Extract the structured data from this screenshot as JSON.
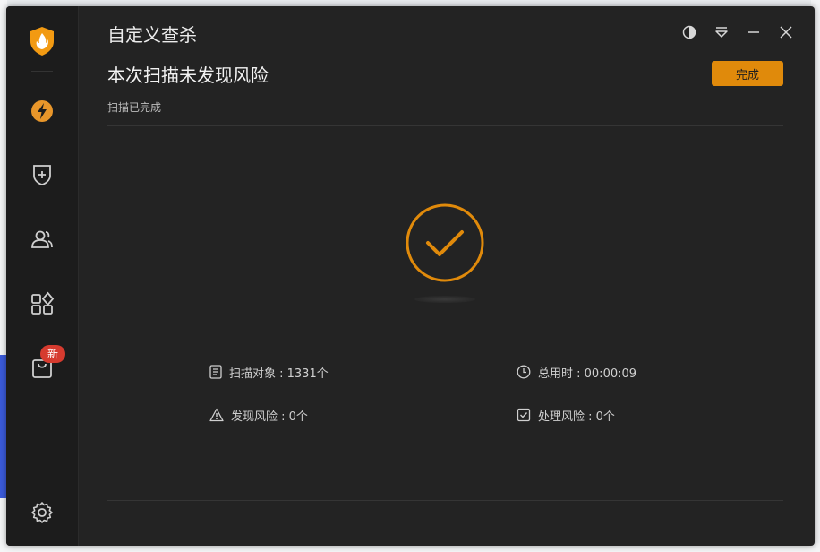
{
  "window": {
    "title": "自定义查杀",
    "headline": "本次扫描未发现风险",
    "subline": "扫描已完成",
    "done_button": "完成"
  },
  "sidebar": {
    "badge": "新",
    "items": [
      {
        "icon": "lightning-icon"
      },
      {
        "icon": "shield-plus-icon"
      },
      {
        "icon": "users-icon"
      },
      {
        "icon": "apps-grid-icon"
      },
      {
        "icon": "bag-icon"
      },
      {
        "icon": "settings-gear-icon"
      }
    ]
  },
  "stats": {
    "scanned_objects": "扫描对象 : 1331个",
    "total_time": "总用时 : 00:00:09",
    "found_risks": "发现风险 : 0个",
    "handled_risks": "处理风险 : 0个"
  },
  "colors": {
    "accent": "#e08a0b",
    "window_bg": "#232323",
    "sidebar_bg": "#1c1c1c",
    "badge": "#d63b2f"
  }
}
